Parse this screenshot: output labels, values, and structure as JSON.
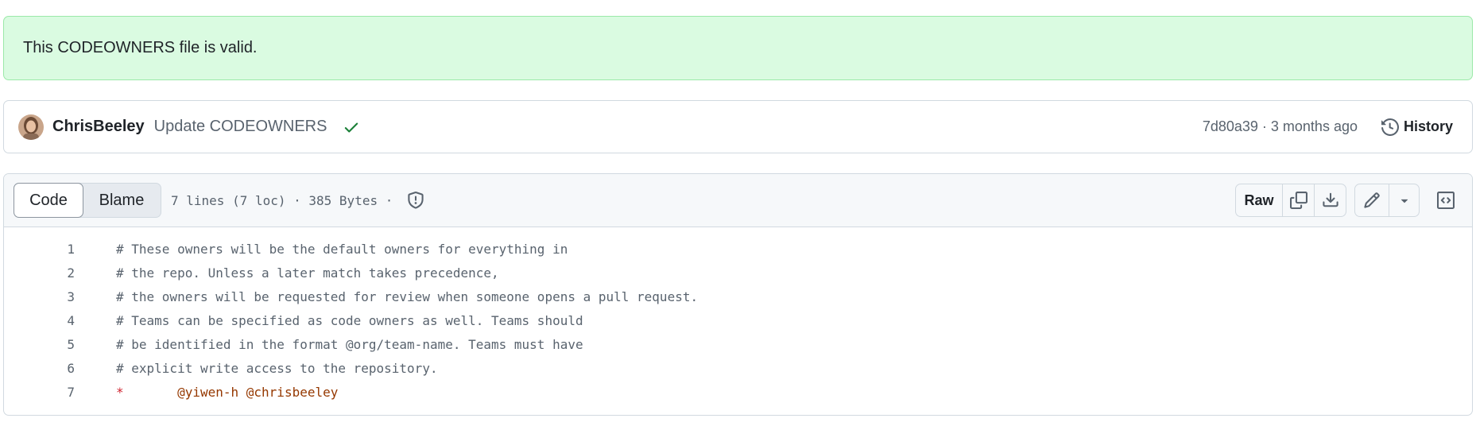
{
  "flash": {
    "message": "This CODEOWNERS file is valid."
  },
  "commit": {
    "author": "ChrisBeeley",
    "message": "Update CODEOWNERS",
    "status_icon": "check-icon",
    "sha": "7d80a39",
    "separator": " · ",
    "time_ago": "3 months ago",
    "history_label": "History"
  },
  "file_header": {
    "tabs": [
      {
        "label": "Code",
        "active": true
      },
      {
        "label": "Blame",
        "active": false
      }
    ],
    "info": "7 lines (7 loc) · 385 Bytes · ",
    "actions": {
      "raw_label": "Raw",
      "copy_icon": "copy-icon",
      "download_icon": "download-icon",
      "edit_icon": "pencil-icon",
      "more_icon": "triangle-down-icon",
      "symbols_icon": "code-square-icon"
    }
  },
  "code_lines": [
    {
      "number": "1",
      "text": "# These owners will be the default owners for everything in"
    },
    {
      "number": "2",
      "text": "# the repo. Unless a later match takes precedence,"
    },
    {
      "number": "3",
      "text": "# the owners will be requested for review when someone opens a pull request."
    },
    {
      "number": "4",
      "text": "# Teams can be specified as code owners as well. Teams should"
    },
    {
      "number": "5",
      "text": "# be identified in the format @org/team-name. Teams must have"
    },
    {
      "number": "6",
      "text": "# explicit write access to the repository."
    },
    {
      "number": "7",
      "pattern": "*",
      "gap": "       ",
      "owners": "@yiwen-h @chrisbeeley"
    }
  ],
  "colors": {
    "flash_bg": "#dafbe1",
    "success_green": "#1a7f37",
    "pattern_red": "#cf222e",
    "owner_orange": "#953800",
    "muted": "#59636e"
  }
}
